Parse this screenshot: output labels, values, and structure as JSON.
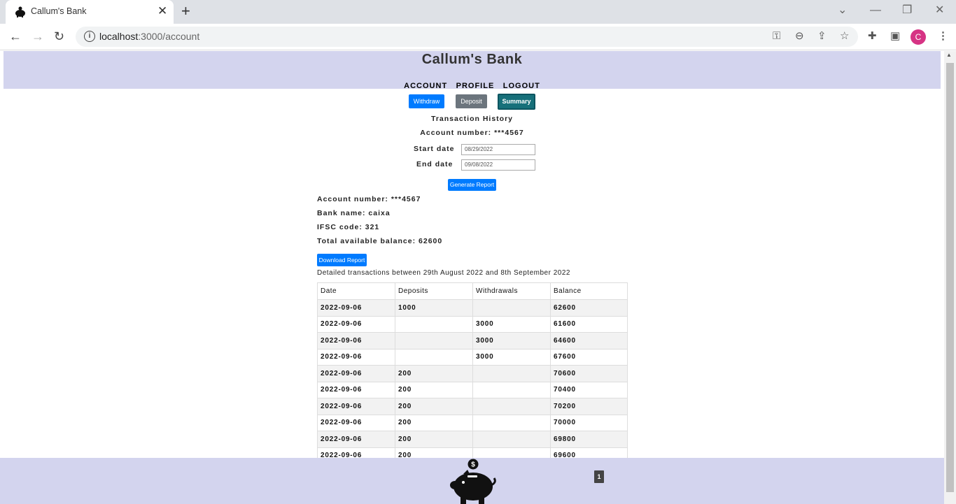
{
  "browser": {
    "tab_title": "Callum's Bank",
    "url_host": "localhost",
    "url_rest": ":3000/account",
    "avatar_letter": "C"
  },
  "header": {
    "bank_title": "Callum's Bank",
    "nav": [
      "ACCOUNT",
      "PROFILE",
      "LOGOUT"
    ]
  },
  "actions": {
    "withdraw": "Withdraw",
    "deposit": "Deposit",
    "summary": "Summary"
  },
  "report_form": {
    "heading": "Transaction History",
    "account_label": "Account number: ***4567",
    "start_label": "Start date",
    "start_value": "08/29/2022",
    "end_label": "End date",
    "end_value": "09/08/2022",
    "generate": "Generate Report"
  },
  "account_info": {
    "account_number": "Account number: ***4567",
    "bank_name": "Bank name: caixa",
    "ifsc": "IFSC code: 321",
    "balance": "Total available balance: 62600",
    "download": "Download Report",
    "detail": "Detailed transactions between 29th August 2022 and 8th September 2022"
  },
  "table": {
    "headers": [
      "Date",
      "Deposits",
      "Withdrawals",
      "Balance"
    ],
    "rows": [
      [
        "2022-09-06",
        "1000",
        "",
        "62600"
      ],
      [
        "2022-09-06",
        "",
        "3000",
        "61600"
      ],
      [
        "2022-09-06",
        "",
        "3000",
        "64600"
      ],
      [
        "2022-09-06",
        "",
        "3000",
        "67600"
      ],
      [
        "2022-09-06",
        "200",
        "",
        "70600"
      ],
      [
        "2022-09-06",
        "200",
        "",
        "70400"
      ],
      [
        "2022-09-06",
        "200",
        "",
        "70200"
      ],
      [
        "2022-09-06",
        "200",
        "",
        "70000"
      ],
      [
        "2022-09-06",
        "200",
        "",
        "69800"
      ],
      [
        "2022-09-06",
        "200",
        "",
        "69600"
      ]
    ]
  },
  "footer": {
    "page_number": "1",
    "coin_symbol": "$"
  },
  "colors": {
    "header_bg": "#d3d4ee",
    "primary": "#007bff",
    "secondary": "#6c757d",
    "info": "#17707a"
  }
}
